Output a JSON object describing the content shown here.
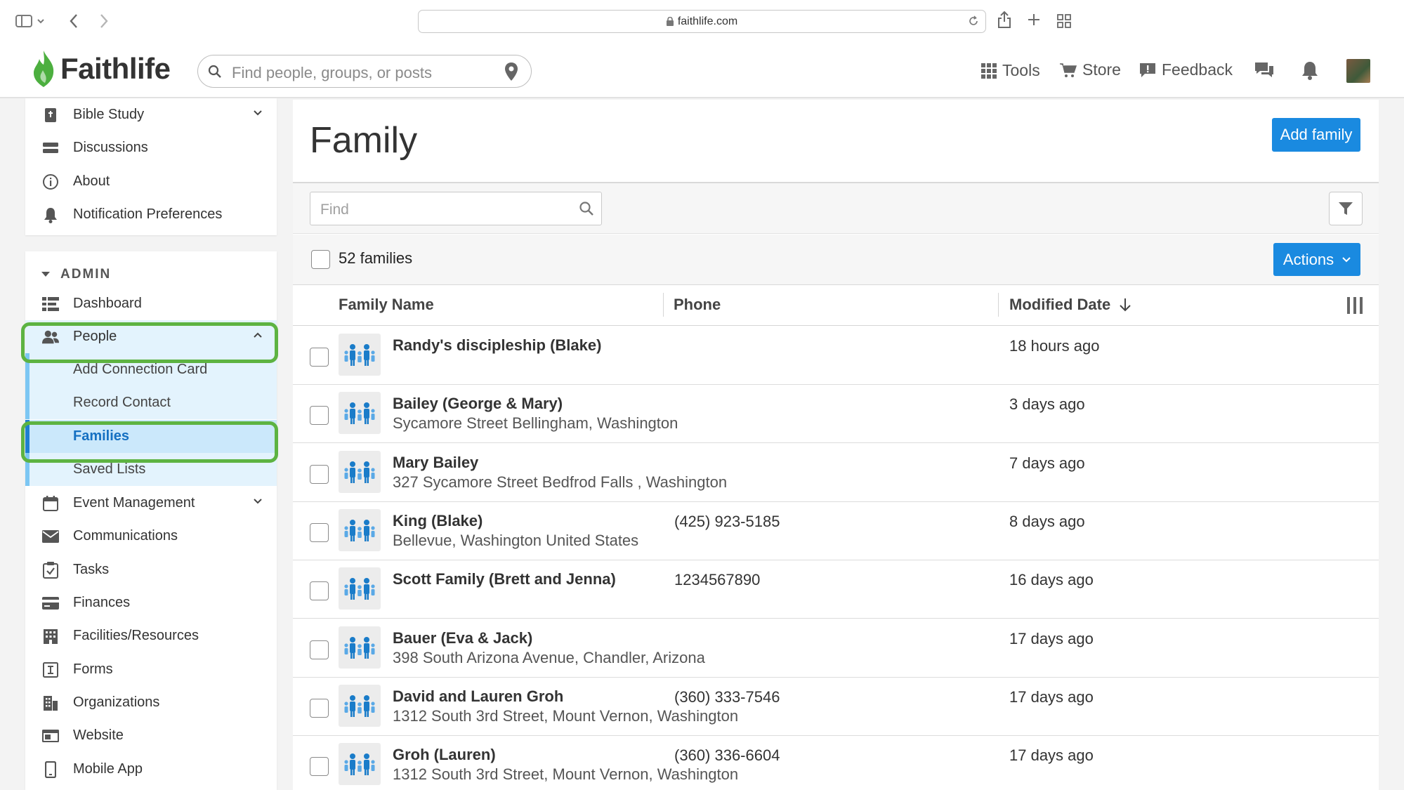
{
  "browser": {
    "url": "faithlife.com"
  },
  "header": {
    "logo_text": "Faithlife",
    "search_placeholder": "Find people, groups, or posts",
    "nav": {
      "tools": "Tools",
      "store": "Store",
      "feedback": "Feedback"
    }
  },
  "sidebar": {
    "top_items": [
      {
        "label": "Bible Study",
        "icon": "bible-icon"
      },
      {
        "label": "Discussions",
        "icon": "discussions-icon"
      },
      {
        "label": "About",
        "icon": "info-icon"
      },
      {
        "label": "Notification Preferences",
        "icon": "bell-icon"
      }
    ],
    "admin_heading": "ADMIN",
    "admin_items": {
      "dashboard": "Dashboard",
      "people": "People",
      "people_sub": [
        "Add Connection Card",
        "Record Contact",
        "Families",
        "Saved Lists"
      ],
      "event_management": "Event Management",
      "communications": "Communications",
      "tasks": "Tasks",
      "finances": "Finances",
      "facilities": "Facilities/Resources",
      "forms": "Forms",
      "organizations": "Organizations",
      "website": "Website",
      "mobile_app": "Mobile App"
    }
  },
  "main": {
    "title": "Family",
    "add_button": "Add family",
    "find_placeholder": "Find",
    "count_label": "52 families",
    "actions_button": "Actions",
    "columns": {
      "name": "Family Name",
      "phone": "Phone",
      "modified": "Modified Date"
    },
    "rows": [
      {
        "name": "Randy's discipleship (Blake)",
        "address": "",
        "phone": "",
        "modified": "18 hours ago"
      },
      {
        "name": "Bailey (George & Mary)",
        "address": "Sycamore Street Bellingham, Washington",
        "phone": "",
        "modified": "3 days ago"
      },
      {
        "name": "Mary Bailey",
        "address": "327 Sycamore Street Bedfrod Falls , Washington",
        "phone": "",
        "modified": "7 days ago"
      },
      {
        "name": "King (Blake)",
        "address": "Bellevue, Washington United States",
        "phone": "(425) 923-5185",
        "modified": "8 days ago"
      },
      {
        "name": "Scott Family (Brett and Jenna)",
        "address": "",
        "phone": "1234567890",
        "modified": "16 days ago"
      },
      {
        "name": "Bauer (Eva & Jack)",
        "address": "398 South Arizona Avenue, Chandler, Arizona",
        "phone": "",
        "modified": "17 days ago"
      },
      {
        "name": "David and Lauren Groh",
        "address": "1312 South 3rd Street, Mount Vernon, Washington",
        "phone": "(360) 333-7546",
        "modified": "17 days ago"
      },
      {
        "name": "Groh (Lauren)",
        "address": "1312 South 3rd Street, Mount Vernon, Washington",
        "phone": "(360) 336-6604",
        "modified": "17 days ago"
      }
    ]
  },
  "colors": {
    "accent": "#1a8ae0",
    "brand_green": "#4caf3f",
    "highlight_green": "#5db342",
    "active_bg": "#cbe8fb"
  }
}
